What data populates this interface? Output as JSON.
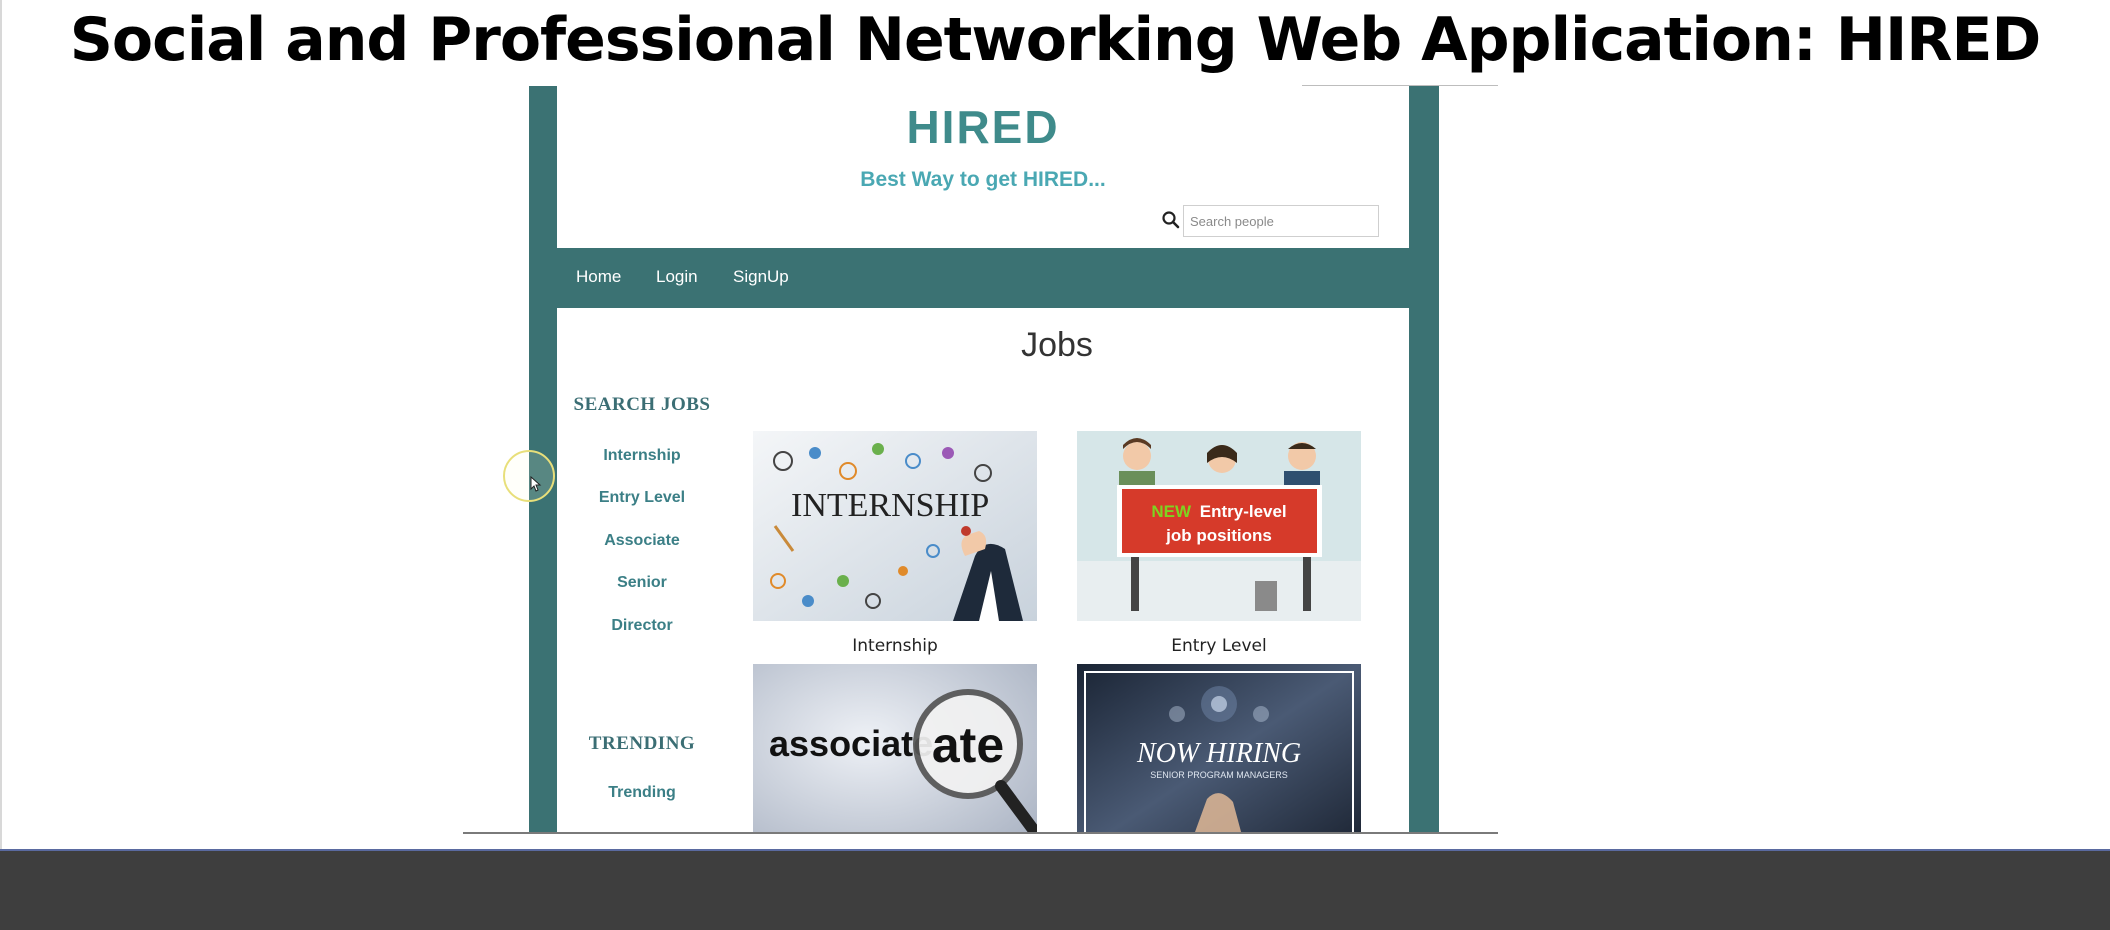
{
  "slide": {
    "title": "Social and Professional Networking Web Application: HIRED"
  },
  "header": {
    "logo": "HIRED",
    "tagline": "Best Way to get HIRED...",
    "search_placeholder": "Search people"
  },
  "nav": {
    "items": [
      "Home",
      "Login",
      "SignUp"
    ]
  },
  "main": {
    "title": "Jobs"
  },
  "sidebar": {
    "search_heading": "SEARCH JOBS",
    "search_links": [
      "Internship",
      "Entry Level",
      "Associate",
      "Senior",
      "Director"
    ],
    "trending_heading": "TRENDING",
    "trending_links": [
      "Trending"
    ]
  },
  "jobs": {
    "internship": {
      "caption": "Internship",
      "image_text": "INTERNSHIP"
    },
    "entry_level": {
      "caption": "Entry Level",
      "image_text_new": "NEW",
      "image_text_line1": "Entry-level",
      "image_text_line2": "job positions"
    },
    "associate": {
      "image_text": "associate"
    },
    "senior": {
      "image_text_main": "NOW HIRING",
      "image_text_sub": "SENIOR PROGRAM MANAGERS"
    }
  },
  "colors": {
    "accent": "#3b7273",
    "logo": "#3f8b8b",
    "tagline": "#4aa8b3",
    "link": "#3b7f86",
    "bottom_bar": "#3e3e3e"
  }
}
